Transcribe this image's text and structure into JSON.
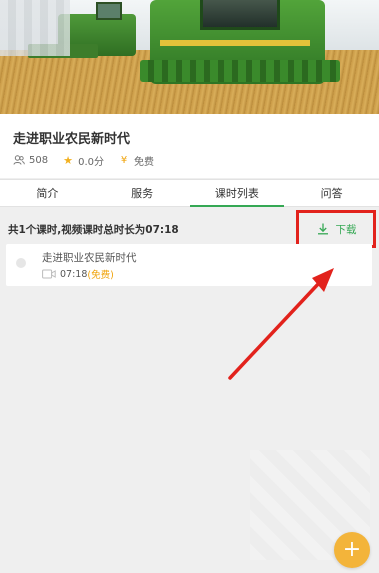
{
  "course": {
    "title": "走进职业农民新时代",
    "students": "508",
    "rating": "0.0分",
    "price": "免费"
  },
  "tabs": [
    {
      "label": "简介",
      "active": false
    },
    {
      "label": "服务",
      "active": false
    },
    {
      "label": "课时列表",
      "active": true
    },
    {
      "label": "问答",
      "active": false
    }
  ],
  "summary": "共1个课时,视频课时总时长为07:18",
  "download": {
    "label": "下载"
  },
  "lessons": [
    {
      "title": "走进职业农民新时代",
      "duration": "07:18",
      "tag": "(免费)"
    }
  ],
  "colors": {
    "accent_green": "#35a854",
    "orange": "#f0a30a",
    "highlight_red": "#e2221c"
  },
  "icons": {
    "students": "users-icon",
    "rating": "star-icon",
    "price": "yen-icon",
    "download": "download-icon",
    "lesson": "video-icon",
    "fab": "plus-icon"
  }
}
